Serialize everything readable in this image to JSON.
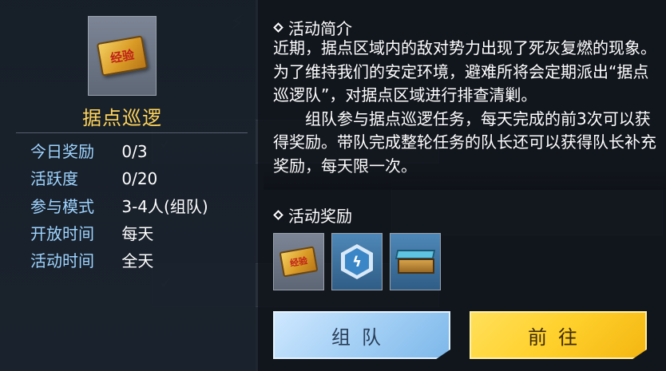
{
  "item": {
    "icon": "exp-ticket-icon",
    "ticket_text": "经验",
    "title": "据点巡逻"
  },
  "info": {
    "rows": [
      {
        "label": "今日奖励",
        "value": "0/3"
      },
      {
        "label": "活跃度",
        "value": "0/20"
      },
      {
        "label": "参与模式",
        "value": "3-4人(组队)"
      },
      {
        "label": "开放时间",
        "value": "每天"
      },
      {
        "label": "活动时间",
        "value": "全天"
      }
    ]
  },
  "description": {
    "heading": "活动简介",
    "paragraph1": "近期，据点区域内的敌对势力出现了死灰复燃的现象。为了维持我们的安定环境，避难所将会定期派出“据点巡逻队”，对据点区域进行排查清剿。",
    "paragraph2": "组队参与据点巡逻任务，每天完成的前3次可以获得奖励。带队完成整轮任务的队长还可以获得队长补充奖励，每天限一次。"
  },
  "rewards": {
    "heading": "活动奖励",
    "items": [
      {
        "icon": "exp-ticket-icon",
        "text": "经验"
      },
      {
        "icon": "energy-bolt-icon"
      },
      {
        "icon": "supply-chest-icon"
      }
    ]
  },
  "buttons": {
    "team": "组队",
    "go": "前往"
  },
  "colors": {
    "title_gold": "#ffd45a",
    "label_blue": "#9ed4ff",
    "team_button": "#a8d2f6",
    "go_button": "#ffd02b"
  }
}
